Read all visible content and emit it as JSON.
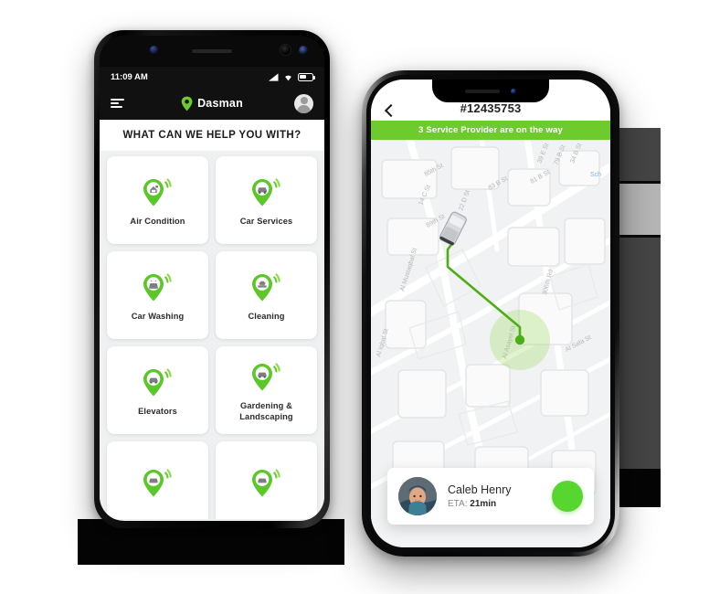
{
  "android": {
    "status": {
      "time": "11:09 AM",
      "signal_icon": "signal-bars-icon",
      "wifi_icon": "wifi-icon",
      "battery_icon": "battery-icon"
    },
    "appbar": {
      "menu_icon": "filter-menu-icon",
      "location_pin_icon": "location-pin-icon",
      "title": "Dasman",
      "avatar_icon": "user-avatar-icon"
    },
    "heading": "WHAT CAN WE HELP YOU WITH?",
    "services": [
      {
        "label": "Air Condition",
        "icon": "air-condition-pin-icon"
      },
      {
        "label": "Car Services",
        "icon": "car-services-pin-icon"
      },
      {
        "label": "Car Washing",
        "icon": "car-washing-pin-icon"
      },
      {
        "label": "Cleaning",
        "icon": "cleaning-pin-icon"
      },
      {
        "label": "Elevators",
        "icon": "elevators-pin-icon"
      },
      {
        "label": "Gardening  &\nLandscaping",
        "icon": "gardening-pin-icon"
      },
      {
        "label": "",
        "icon": "service-pin-icon"
      },
      {
        "label": "",
        "icon": "service-pin-icon"
      }
    ]
  },
  "iphone": {
    "header": {
      "back_icon": "back-chevron-icon",
      "order_id": "#12435753"
    },
    "banner": "3 Service Provider are on the way",
    "map": {
      "street_labels": [
        "85th St",
        "14 C St",
        "22 D St",
        "89th St",
        "83 B St",
        "81 B St",
        "39 E St",
        "79 B St",
        "34 B St",
        "Al Mustaqbal St",
        "306th Rd",
        "Al Safa St",
        "Al Asayel St",
        "Sch"
      ],
      "vehicle_icon": "vehicle-marker-icon",
      "destination_icon": "destination-dot-icon",
      "route_color": "#4caf15"
    },
    "driver": {
      "avatar_icon": "driver-avatar-icon",
      "name": "Caleb Henry",
      "eta_label": "ETA:",
      "eta_value": "21min",
      "call_icon": "phone-call-icon"
    }
  },
  "colors": {
    "accent_green": "#6ecb2d",
    "call_green": "#56d62e",
    "route_green": "#4caf15",
    "dark_frame": "#050505",
    "screen_bg": "#eef0f2"
  }
}
